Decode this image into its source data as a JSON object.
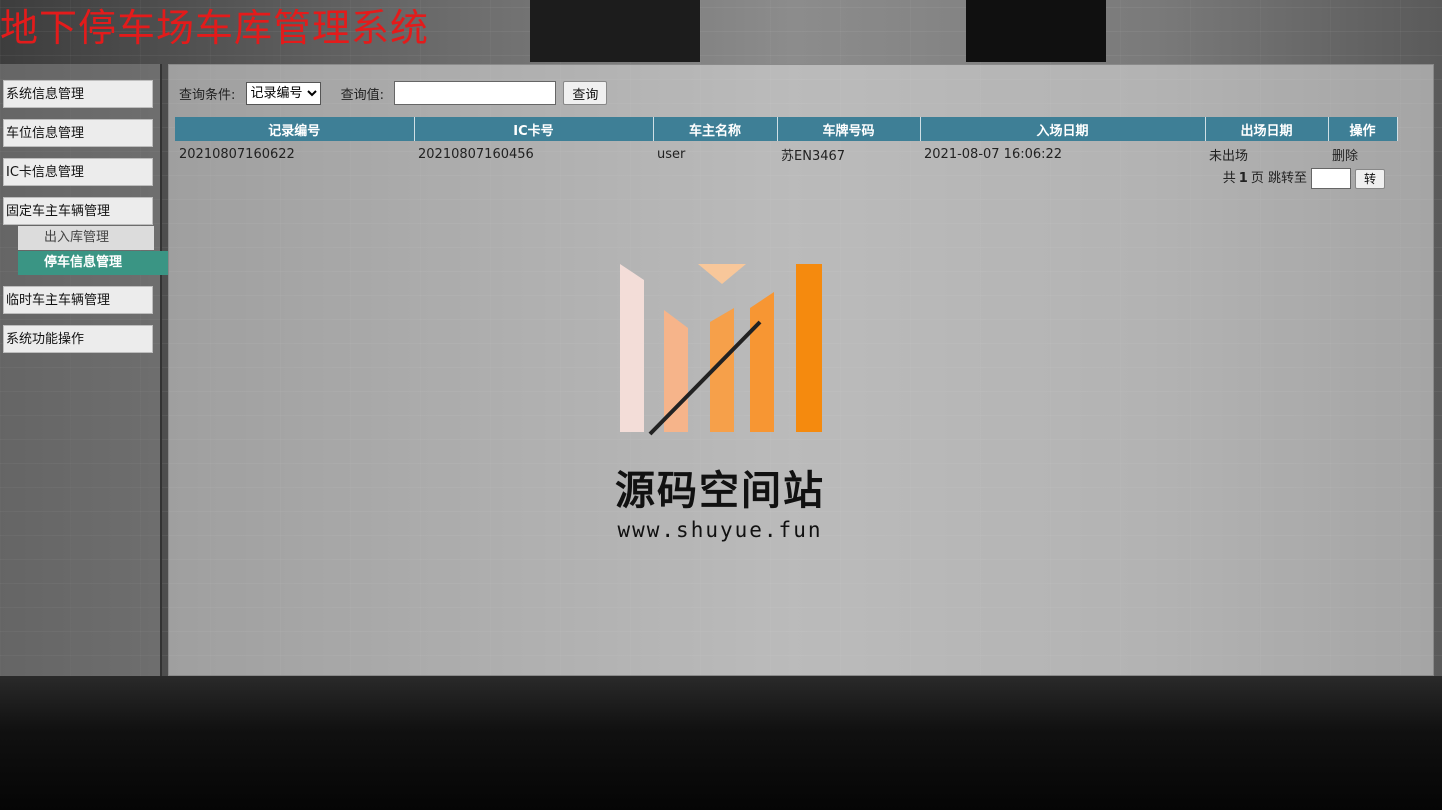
{
  "app": {
    "title": "地下停车场车库管理系统"
  },
  "colors": {
    "title": "#e31b1b",
    "table_header": "#3e7f96",
    "active_menu": "#3a9584"
  },
  "sidebar": {
    "items": [
      {
        "label": "系统信息管理"
      },
      {
        "label": "车位信息管理"
      },
      {
        "label": "IC卡信息管理"
      },
      {
        "label": "固定车主车辆管理",
        "children": [
          {
            "label": "出入库管理"
          },
          {
            "label": "停车信息管理",
            "active": true
          }
        ]
      },
      {
        "label": "临时车主车辆管理"
      },
      {
        "label": "系统功能操作"
      }
    ]
  },
  "search": {
    "condition_label": "查询条件:",
    "condition_selected": "记录编号",
    "value_label": "查询值:",
    "value": "",
    "button_label": "查询"
  },
  "table": {
    "columns": [
      "记录编号",
      "IC卡号",
      "车主名称",
      "车牌号码",
      "入场日期",
      "出场日期",
      "操作"
    ],
    "rows": [
      {
        "record_no": "20210807160622",
        "ic_card": "20210807160456",
        "owner": "user",
        "plate": "苏EN3467",
        "entry_date": "2021-08-07 16:06:22",
        "exit_date": "未出场",
        "action": "删除"
      }
    ]
  },
  "pager": {
    "prefix": "共",
    "total_pages": "1",
    "suffix": "页 跳转至",
    "jump_value": "",
    "go_label": "转"
  },
  "watermark": {
    "text": "源码空间站",
    "url": "www.shuyue.fun",
    "logo_icon": "bar-logo-icon"
  }
}
